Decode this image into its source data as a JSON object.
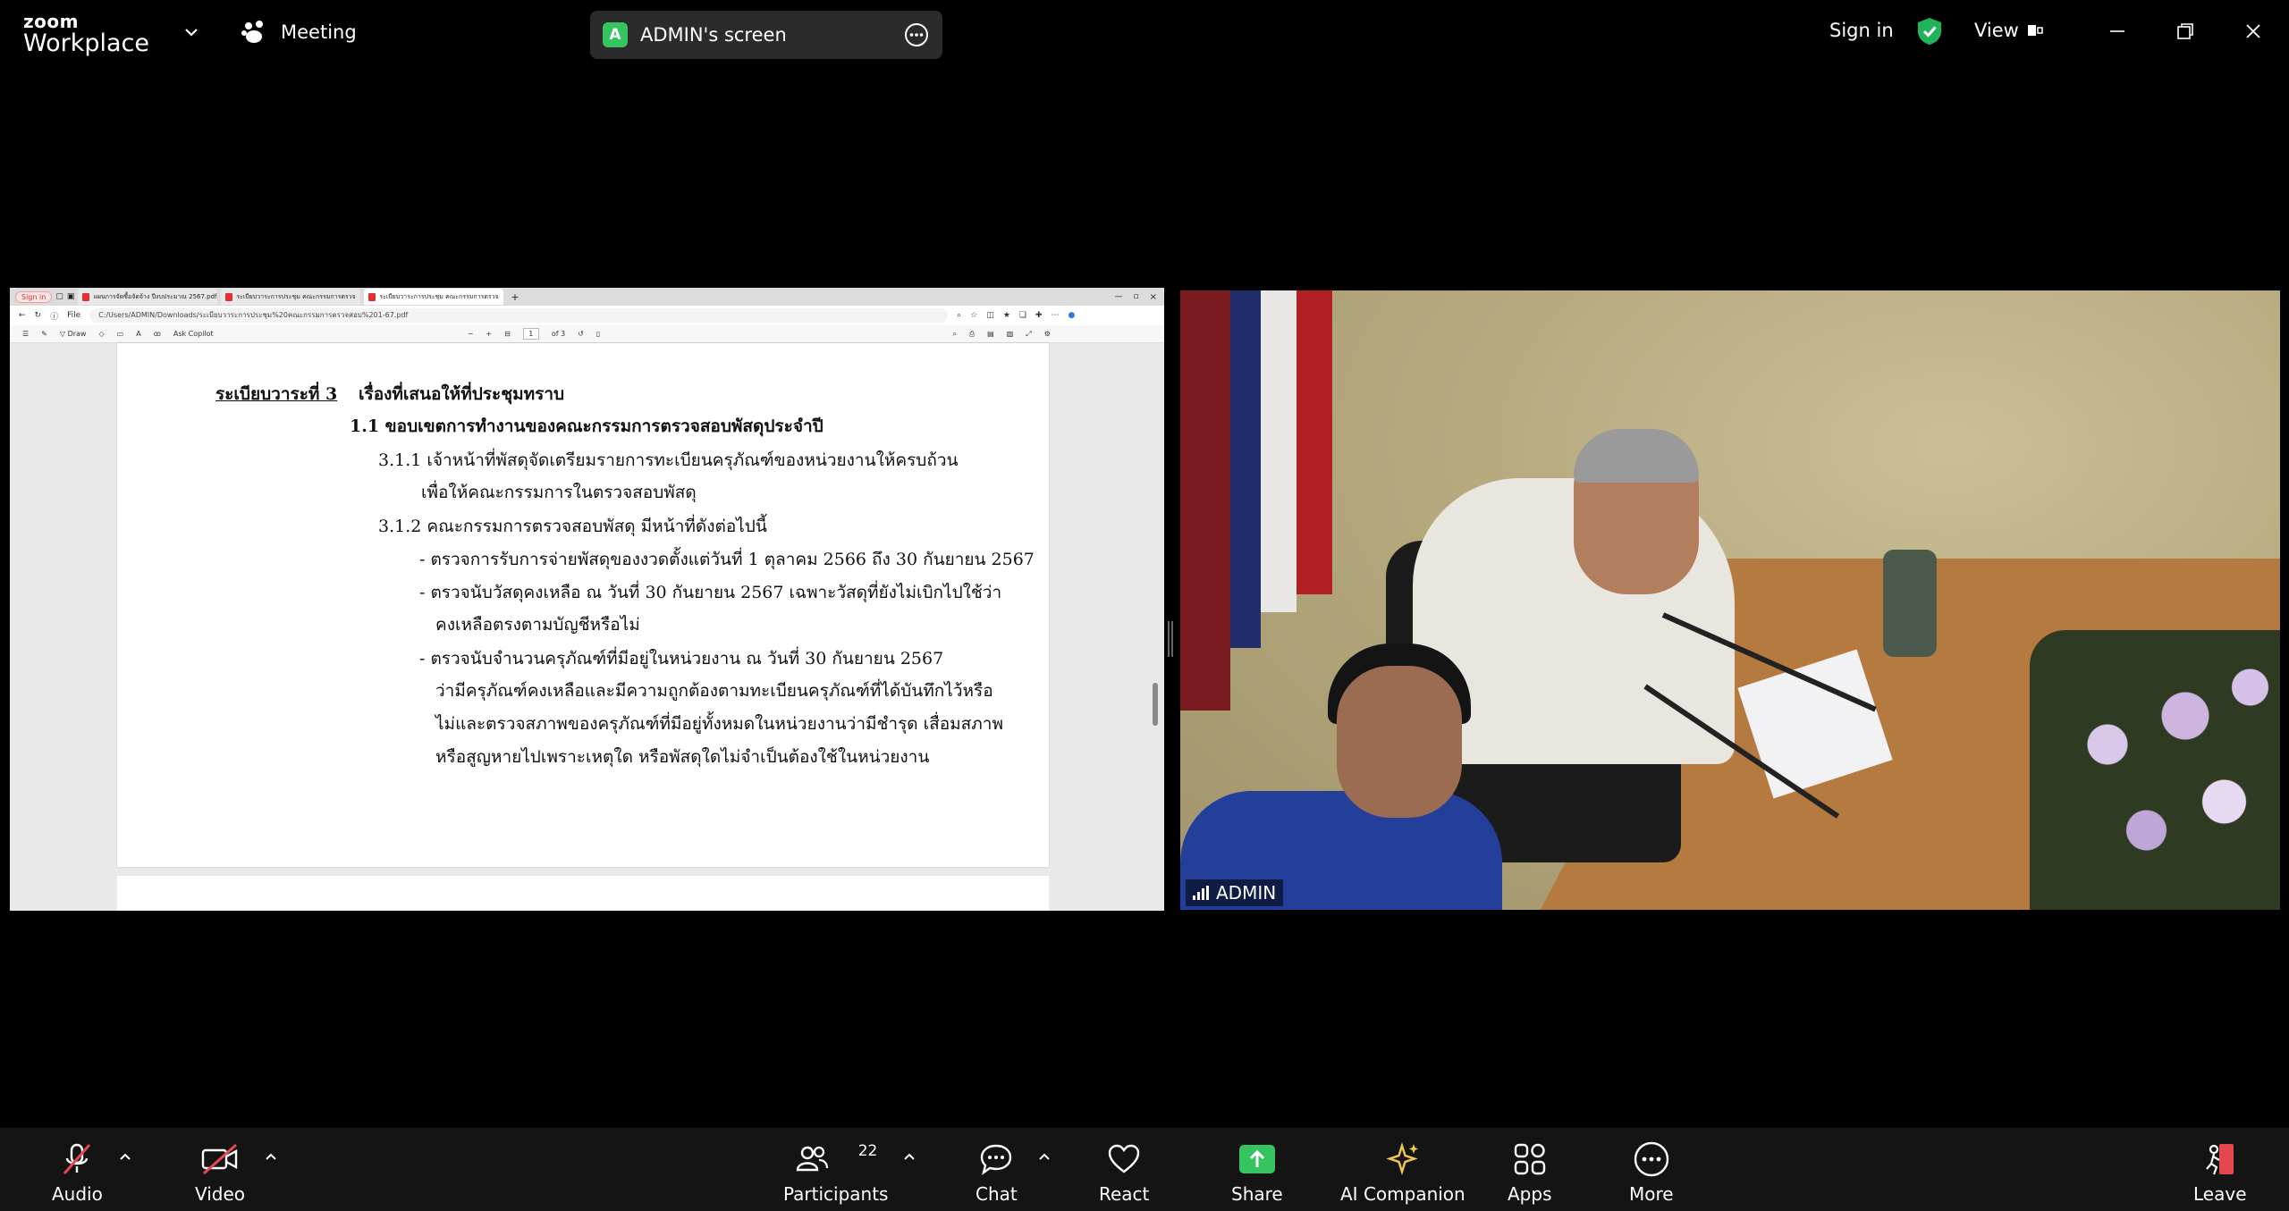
{
  "app": {
    "logo_small": "zoom",
    "logo_large": "Workplace",
    "meeting_label": "Meeting",
    "share_badge": "A",
    "share_title": "ADMIN's screen",
    "signin": "Sign in",
    "view": "View"
  },
  "browser": {
    "signin": "Sign in",
    "tabs": [
      {
        "label": "แผนการจัดซื้อจัดจ้าง ปีงบประมาณ 2567.pdf"
      },
      {
        "label": "ระเบียบวาระการประชุม คณะกรรมการตรวจ"
      },
      {
        "label": "ระเบียบวาระการประชุม คณะกรรมการตรวจ"
      }
    ],
    "url_label": "File",
    "url": "C:/Users/ADMIN/Downloads/ระเบียบวาระการประชุม%20คณะกรรมการตรวจสอบ%201-67.pdf",
    "pdfbar": {
      "draw": "Draw",
      "ask": "Ask Copilot",
      "page": "1",
      "of": "of 3"
    }
  },
  "document": {
    "agenda": "ระเบียบวาระที่ 3",
    "heading": "เรื่องที่เสนอให้ที่ประชุมทราบ",
    "sub1": "1.1 ขอบเขตการทำงานของคณะกรรมการตรวจสอบพัสดุประจำปี",
    "l1": "3.1.1  เจ้าหน้าที่พัสดุจัดเตรียมรายการทะเบียนครุภัณฑ์ของหน่วยงานให้ครบถ้วน",
    "l2": "เพื่อให้คณะกรรมการในตรวจสอบพัสดุ",
    "l3": "3.1.2 คณะกรรมการตรวจสอบพัสดุ มีหน้าที่ดังต่อไปนี้",
    "l4": "-  ตรวจการรับการจ่ายพัสดุของงวดตั้งแต่วันที่ 1 ตุลาคม 2566 ถึง 30 กันยายน 2567",
    "l5": "-  ตรวจนับวัสดุคงเหลือ ณ วันที่ 30 กันยายน 2567 เฉพาะวัสดุที่ยังไม่เบิกไปใช้ว่า",
    "l6": "คงเหลือตรงตามบัญชีหรือไม่",
    "l7": "-  ตรวจนับจำนวนครุภัณฑ์ที่มีอยู่ในหน่วยงาน ณ วันที่ 30 กันยายน 2567",
    "l8": "ว่ามีครุภัณฑ์คงเหลือและมีความถูกต้องตามทะเบียนครุภัณฑ์ที่ได้บันทึกไว้หรือ",
    "l9": "ไม่และตรวจสภาพของครุภัณฑ์ที่มีอยู่ทั้งหมดในหน่วยงานว่ามีชำรุด เสื่อมสภาพ",
    "l10": "หรือสูญหายไปเพราะเหตุใด หรือพัสดุใดไม่จำเป็นต้องใช้ในหน่วยงาน"
  },
  "video": {
    "name": "ADMIN"
  },
  "toolbar": {
    "audio": "Audio",
    "video": "Video",
    "participants": "Participants",
    "participants_count": "22",
    "chat": "Chat",
    "react": "React",
    "share": "Share",
    "ai": "AI Companion",
    "apps": "Apps",
    "more": "More",
    "leave": "Leave"
  },
  "colors": {
    "share_green": "#35c45f",
    "ai_yellow": "#f2c94c",
    "mute_red": "#e5484d",
    "toolbar_bg": "#141414"
  }
}
